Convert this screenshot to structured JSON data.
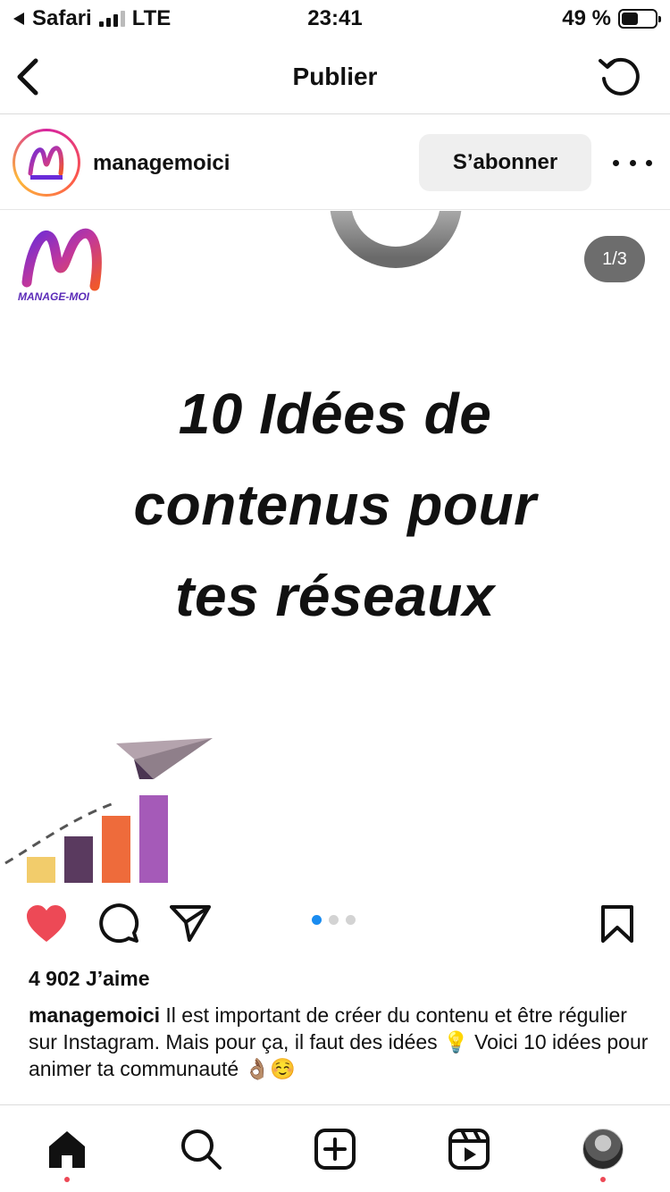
{
  "status_bar": {
    "back_app": "Safari",
    "network": "LTE",
    "time": "23:41",
    "battery": "49 %",
    "battery_level": 0.49
  },
  "nav": {
    "title": "Publier"
  },
  "post": {
    "username": "managemoici",
    "subscribe_label": "S’abonner",
    "logo_text": "MANAGE-MOI",
    "page_indicator": "1/3",
    "headline": [
      "10 Idées de",
      "contenus pour",
      "tes réseaux"
    ],
    "carousel": {
      "count": 3,
      "active": 1
    },
    "likes": "4 902 J’aime",
    "caption_user": "managemoici",
    "caption_text": " Il est important de créer du contenu et être régulier sur Instagram. Mais pour ça, il faut des idées 💡 Voici 10 idées pour animer ta communauté 👌🏽☺️",
    "liked": true
  },
  "colors": {
    "like": "#ed4956",
    "dot_active": "#1a8cf0",
    "bar1": "#f2cc6b",
    "bar2": "#5a3a5f",
    "bar3": "#ee6b3b",
    "bar4": "#a55ab8",
    "plane": "#b4a3ad"
  },
  "icons": {
    "back": "chevron-left-icon",
    "refresh": "refresh-icon",
    "more": "more-horizontal-icon",
    "like": "heart-icon",
    "comment": "comment-icon",
    "share": "send-icon",
    "save": "bookmark-icon",
    "tabs": [
      "home-icon",
      "search-icon",
      "create-icon",
      "reels-icon",
      "profile-icon"
    ]
  }
}
